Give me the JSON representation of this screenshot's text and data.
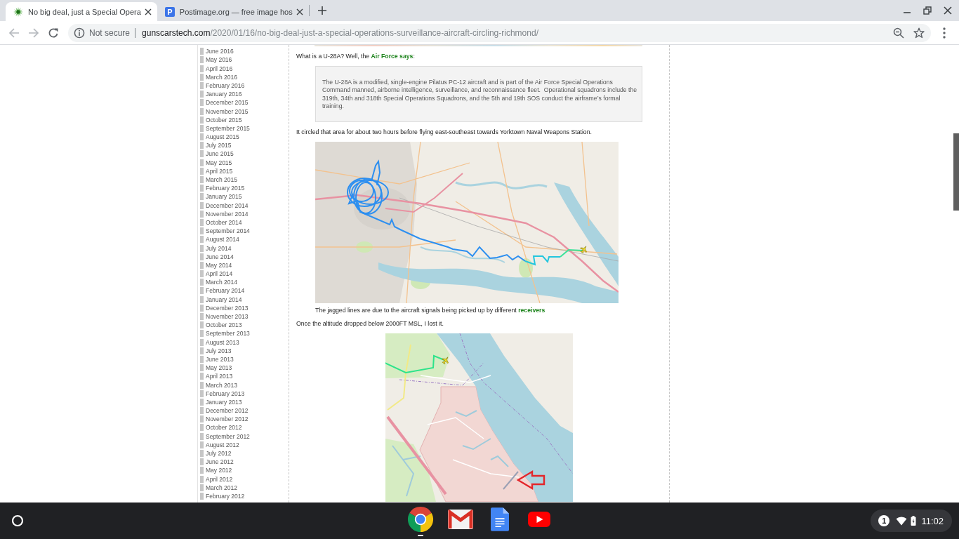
{
  "browser": {
    "tabs": [
      {
        "title": "No big deal, just a Special Opera",
        "selected": true,
        "favicon": {
          "kind": "burst"
        }
      },
      {
        "title": "Postimage.org — free image hos",
        "selected": false,
        "favicon": {
          "kind": "letter",
          "letter": "P"
        }
      }
    ],
    "nav_buttons": [
      {
        "kind": "back",
        "disabled": true
      },
      {
        "kind": "forward",
        "disabled": true
      },
      {
        "kind": "reload",
        "disabled": false
      }
    ],
    "address_bar": {
      "security": "Not secure",
      "domain": "gunscarstech.com",
      "path": "/2020/01/16/no-big-deal-just-a-special-operations-surveillance-aircraft-circling-richmond/"
    }
  },
  "sidebar": {
    "archive_links": [
      "June 2016",
      "May 2016",
      "April 2016",
      "March 2016",
      "February 2016",
      "January 2016",
      "December 2015",
      "November 2015",
      "October 2015",
      "September 2015",
      "August 2015",
      "July 2015",
      "June 2015",
      "May 2015",
      "April 2015",
      "March 2015",
      "February 2015",
      "January 2015",
      "December 2014",
      "November 2014",
      "October 2014",
      "September 2014",
      "August 2014",
      "July 2014",
      "June 2014",
      "May 2014",
      "April 2014",
      "March 2014",
      "February 2014",
      "January 2014",
      "December 2013",
      "November 2013",
      "October 2013",
      "September 2013",
      "August 2013",
      "July 2013",
      "June 2013",
      "May 2013",
      "April 2013",
      "March 2013",
      "February 2013",
      "January 2013",
      "December 2012",
      "November 2012",
      "October 2012",
      "September 2012",
      "August 2012",
      "July 2012",
      "June 2012",
      "May 2012",
      "April 2012",
      "March 2012",
      "February 2012"
    ]
  },
  "article": {
    "blocks": [
      {
        "kind": "cutimage"
      },
      {
        "kind": "paragraph",
        "parts": [
          {
            "kind": "text",
            "text": "What is a U-28A? Well, the "
          },
          {
            "kind": "link",
            "text": "Air Force says"
          },
          {
            "kind": "text",
            "text": ":"
          }
        ]
      },
      {
        "kind": "quote",
        "text": "The U-28A is a modified, single-engine Pilatus PC-12 aircraft and is part of the Air Force Special Operations Command manned, airborne intelligence, surveillance, and reconnaissance fleet.  Operational squadrons include the 319th, 34th and 318th Special Operations Squadrons, and the 5th and 19th SOS conduct the airframe’s formal training."
      },
      {
        "kind": "paragraph",
        "parts": [
          {
            "kind": "text",
            "text": "It circled that area for about two hours before flying east-southeast towards Yorktown Naval Weapons Station."
          }
        ]
      },
      {
        "kind": "routemap"
      },
      {
        "kind": "caption",
        "parts": [
          {
            "kind": "text",
            "text": "The jagged lines are due to the aircraft signals being picked up by different "
          },
          {
            "kind": "link",
            "text": "receivers"
          }
        ]
      },
      {
        "kind": "paragraph",
        "parts": [
          {
            "kind": "text",
            "text": "Once the altitude dropped below 2000FT MSL, I lost it."
          }
        ]
      },
      {
        "kind": "closeupmap"
      }
    ]
  },
  "taskbar": {
    "apps": [
      {
        "kind": "chrome",
        "running": true
      },
      {
        "kind": "gmail",
        "running": false
      },
      {
        "kind": "docs",
        "running": false
      },
      {
        "kind": "youtube",
        "running": false
      }
    ],
    "notification_count": "1",
    "time": "11:02"
  }
}
